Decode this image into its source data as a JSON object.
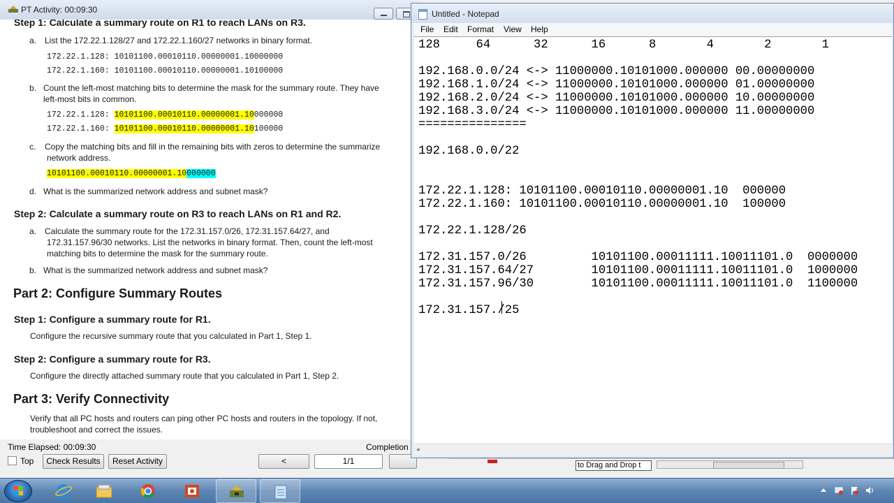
{
  "pt_window": {
    "title": "PT Activity: 00:09:30",
    "content": {
      "step1_heading": "Step 1:  Calculate a summary route on R1 to reach LANs on R3.",
      "item_a_label": "a.",
      "item_a_text": "List the 172.22.1.128/27 and 172.22.1.160/27 networks in binary format.",
      "bin_line1": "172.22.1.128:  10101100.00010110.00000001.10000000",
      "bin_line2": "172.22.1.160:  10101100.00010110.00000001.10100000",
      "item_b_label": "b.",
      "item_b_text_1": "Count the left-most matching bits to determine the mask for the summary route. They have",
      "item_b_text_2": "left-most bits in common.",
      "match1_prefix": "172.22.1.128:  ",
      "match1_hl": "10101100.00010110.00000001.10",
      "match1_rest": "000000",
      "match2_prefix": "172.22.1.160:  ",
      "match2_hl": "10101100.00010110.00000001.10",
      "match2_rest": "100000",
      "item_c_label": "c.",
      "item_c_text_1": "Copy the matching bits and fill in the remaining bits with zeros to determine the summarize",
      "item_c_text_2": "network address.",
      "copy_hl": "10101100.00010110.00000001.10",
      "copy_zeros": "000000",
      "item_d_label": "d.",
      "item_d_text": "What is the summarized network address and subnet mask?",
      "step2_heading": "Step 2:  Calculate a summary route on R3 to reach LANs on R1 and R2.",
      "step2_a_label": "a.",
      "step2_a_text_1": "Calculate the summary route for the 172.31.157.0/26, 172.31.157.64/27, and",
      "step2_a_text_2": "172.31.157.96/30 networks. List the networks in binary format. Then, count the left-most",
      "step2_a_text_3": "matching bits to determine the mask for the summary route.",
      "step2_b_label": "b.",
      "step2_b_text": "What is the summarized network address and subnet mask?",
      "part2_heading": "Part 2:  Configure Summary Routes",
      "p2_step1_heading": "Step 1:  Configure a summary route for R1.",
      "p2_step1_text": "Configure the recursive summary route that you calculated in Part 1, Step 1.",
      "p2_step2_heading": "Step 2:  Configure a summary route for R3.",
      "p2_step2_text": "Configure the directly attached summary route that you calculated in Part 1, Step 2.",
      "part3_heading": "Part 3:  Verify Connectivity",
      "part3_text_1": "Verify that all PC hosts and routers can ping other PC hosts and routers in the topology. If not,",
      "part3_text_2": "troubleshoot and correct the issues."
    },
    "footer": {
      "time_elapsed": "Time Elapsed: 00:09:30",
      "completion": "Completion",
      "top_label": "Top",
      "check_results": "Check Results",
      "reset_activity": "Reset Activity",
      "prev_label": "<",
      "page_indicator": "1/1"
    }
  },
  "notepad": {
    "title": "Untitled - Notepad",
    "menu": [
      "File",
      "Edit",
      "Format",
      "View",
      "Help"
    ],
    "lines": [
      "128     64      32      16      8       4       2       1",
      "",
      "192.168.0.0/24 <-> 11000000.10101000.000000 00.00000000",
      "192.168.1.0/24 <-> 11000000.10101000.000000 01.00000000",
      "192.168.2.0/24 <-> 11000000.10101000.000000 10.00000000",
      "192.168.3.0/24 <-> 11000000.10101000.000000 11.00000000",
      "===============",
      "",
      "192.168.0.0/22",
      "",
      "",
      "172.22.1.128: 10101100.00010110.00000001.10  000000",
      "172.22.1.160: 10101100.00010110.00000001.10  100000",
      "",
      "172.22.1.128/26",
      "",
      "172.31.157.0/26         10101100.00011111.10011101.0  0000000",
      "172.31.157.64/27        10101100.00011111.10011101.0  1000000",
      "172.31.157.96/30        10101100.00011111.10011101.0  1100000",
      "",
      "172.31.157./25"
    ]
  },
  "background": {
    "drag_drop_text": "to Drag and Drop t"
  },
  "taskbar": {
    "apps": [
      "start-orb",
      "internet-explorer-icon",
      "file-explorer-icon",
      "chrome-icon",
      "presentation-app-icon",
      "packet-tracer-icon",
      "notepad-icon"
    ],
    "tray_icons": [
      "show-hidden-icons-arrow",
      "network-icon",
      "flag-icon",
      "volume-icon"
    ]
  },
  "colors": {
    "highlight_yellow": "#ffff00",
    "highlight_cyan": "#00ffff",
    "title_bar": "#dfe8f3",
    "taskbar": "#5d86b3"
  }
}
